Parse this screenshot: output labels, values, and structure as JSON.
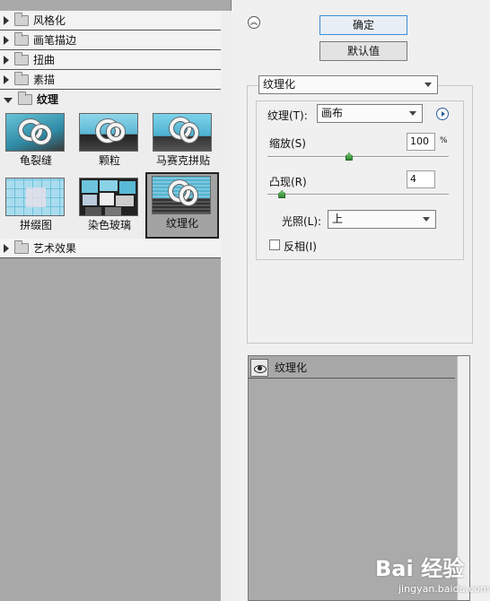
{
  "categories": [
    {
      "label": "风格化",
      "expanded": false
    },
    {
      "label": "画笔描边",
      "expanded": false
    },
    {
      "label": "扭曲",
      "expanded": false
    },
    {
      "label": "素描",
      "expanded": false
    },
    {
      "label": "纹理",
      "expanded": true
    }
  ],
  "thumbnails": [
    {
      "label": "龟裂缝",
      "icon": "craquelure-preview"
    },
    {
      "label": "颗粒",
      "icon": "grain-preview"
    },
    {
      "label": "马赛克拼贴",
      "icon": "mosaic-tiles-preview"
    },
    {
      "label": "拼缀图",
      "icon": "patchwork-preview"
    },
    {
      "label": "染色玻璃",
      "icon": "stained-glass-preview"
    },
    {
      "label": "纹理化",
      "icon": "texturizer-preview",
      "selected": true
    }
  ],
  "category_after": {
    "label": "艺术效果"
  },
  "buttons": {
    "ok": "确定",
    "default": "默认值"
  },
  "filter_select": {
    "value": "纹理化"
  },
  "texture": {
    "label": "纹理(T):",
    "value": "画布"
  },
  "scaling": {
    "label": "缩放(S)",
    "value": "100",
    "unit": "%",
    "level": 0.45
  },
  "relief": {
    "label": "凸现(R)",
    "value": "4",
    "level": 0.08
  },
  "light": {
    "label": "光照(L):",
    "value": "上"
  },
  "invert": {
    "label": "反相(I)",
    "checked": false
  },
  "layer": {
    "name": "纹理化"
  },
  "watermark": {
    "text": "Bai 经验",
    "sub": "jingyan.baidu.com"
  },
  "colors": {
    "window_bg": "#f0f0f0",
    "preview_bg": "#a9a9a9",
    "accent": "#2a5d9f"
  }
}
